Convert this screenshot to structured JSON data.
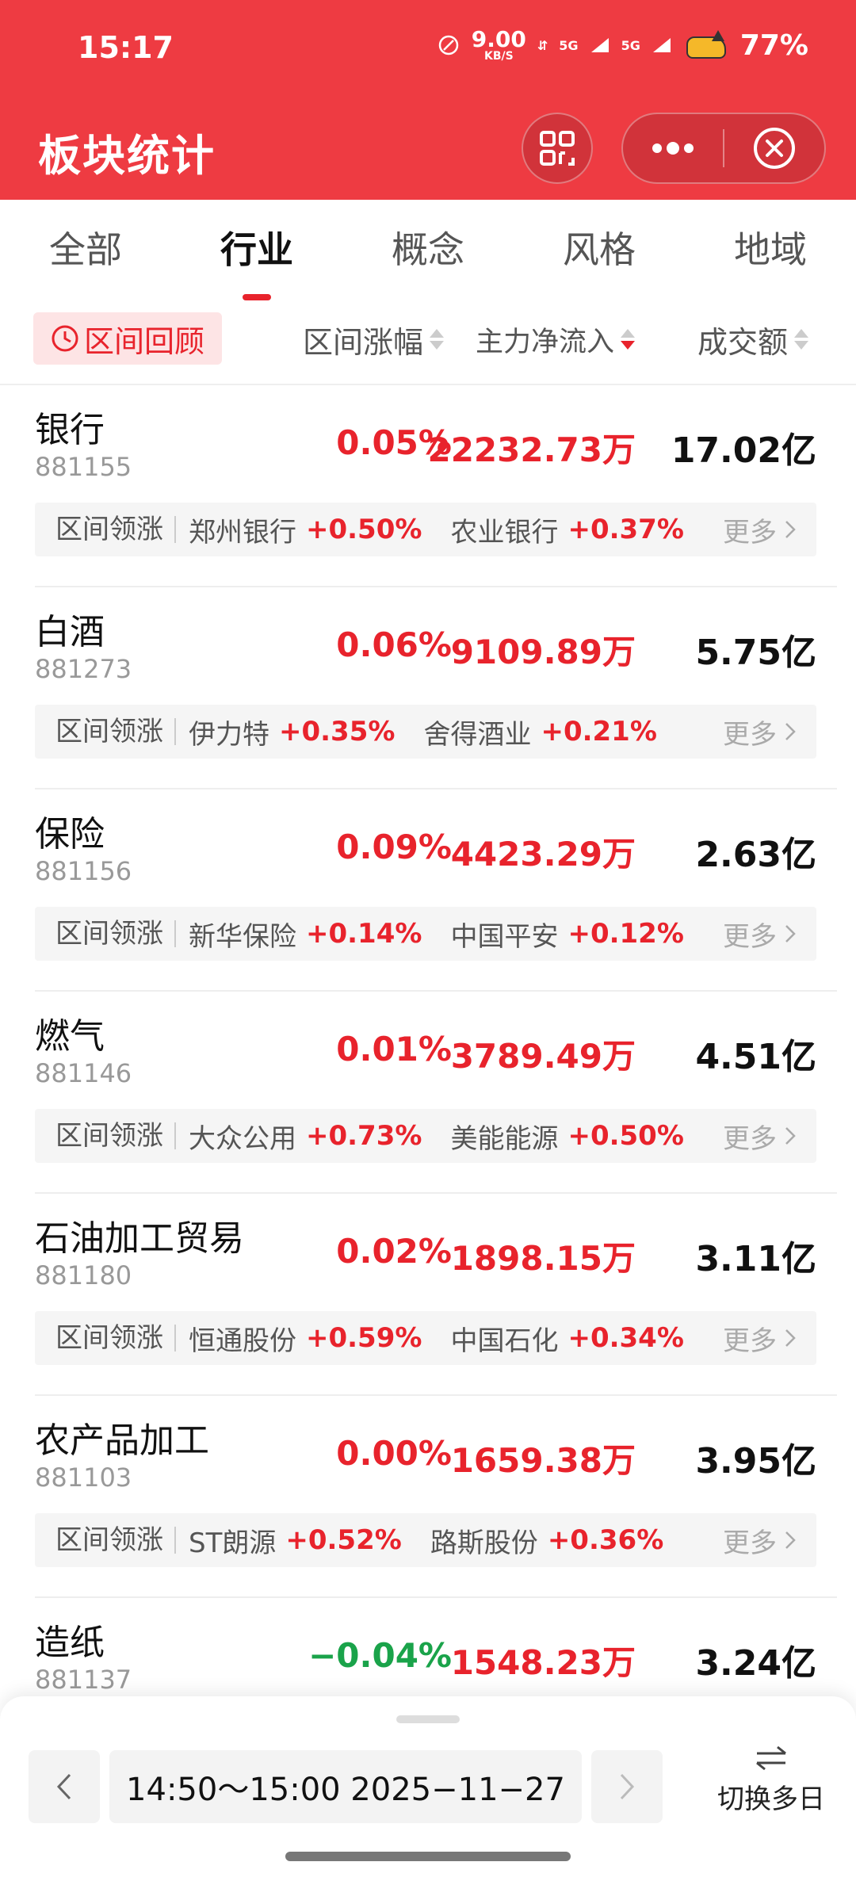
{
  "status_bar": {
    "time": "15:17",
    "speed_value": "9.00",
    "speed_unit": "KB/S",
    "network_1": "5G",
    "network_2": "5G",
    "battery": "77%"
  },
  "header": {
    "title": "板块统计"
  },
  "tabs": [
    {
      "label": "全部",
      "active": false
    },
    {
      "label": "行业",
      "active": true
    },
    {
      "label": "概念",
      "active": false
    },
    {
      "label": "风格",
      "active": false
    },
    {
      "label": "地域",
      "active": false
    }
  ],
  "columns": {
    "range_review": "区间回顾",
    "range_change": "区间涨幅",
    "main_net_inflow": "主力净流入",
    "turnover": "成交额",
    "sorted_by": "main_net_inflow",
    "sort_direction": "desc"
  },
  "rows": [
    {
      "name": "银行",
      "code": "881155",
      "change": "0.05%",
      "change_color": "#e8232c",
      "inflow": "22232.73万",
      "turnover": "17.02亿",
      "leader_label": "区间领涨",
      "stock1": "郑州银行",
      "gain1": "+0.50%",
      "stock2": "农业银行",
      "gain2": "+0.37%",
      "more": "更多"
    },
    {
      "name": "白酒",
      "code": "881273",
      "change": "0.06%",
      "change_color": "#e8232c",
      "inflow": "9109.89万",
      "turnover": "5.75亿",
      "leader_label": "区间领涨",
      "stock1": "伊力特",
      "gain1": "+0.35%",
      "stock2": "舍得酒业",
      "gain2": "+0.21%",
      "more": "更多"
    },
    {
      "name": "保险",
      "code": "881156",
      "change": "0.09%",
      "change_color": "#e8232c",
      "inflow": "4423.29万",
      "turnover": "2.63亿",
      "leader_label": "区间领涨",
      "stock1": "新华保险",
      "gain1": "+0.14%",
      "stock2": "中国平安",
      "gain2": "+0.12%",
      "more": "更多"
    },
    {
      "name": "燃气",
      "code": "881146",
      "change": "0.01%",
      "change_color": "#e8232c",
      "inflow": "3789.49万",
      "turnover": "4.51亿",
      "leader_label": "区间领涨",
      "stock1": "大众公用",
      "gain1": "+0.73%",
      "stock2": "美能能源",
      "gain2": "+0.50%",
      "more": "更多"
    },
    {
      "name": "石油加工贸易",
      "code": "881180",
      "change": "0.02%",
      "change_color": "#e8232c",
      "inflow": "1898.15万",
      "turnover": "3.11亿",
      "leader_label": "区间领涨",
      "stock1": "恒通股份",
      "gain1": "+0.59%",
      "stock2": "中国石化",
      "gain2": "+0.34%",
      "more": "更多"
    },
    {
      "name": "农产品加工",
      "code": "881103",
      "change": "0.00%",
      "change_color": "#e8232c",
      "inflow": "1659.38万",
      "turnover": "3.95亿",
      "leader_label": "区间领涨",
      "stock1": "ST朗源",
      "gain1": "+0.52%",
      "stock2": "路斯股份",
      "gain2": "+0.36%",
      "more": "更多"
    },
    {
      "name": "造纸",
      "code": "881137",
      "change": "−0.04%",
      "change_color": "#1aa34a",
      "inflow": "1548.23万",
      "turnover": "3.24亿"
    }
  ],
  "bottom": {
    "date_range": "14:50～15:00 2025−11−27",
    "multi_day": "切换多日"
  },
  "colors": {
    "brand_red": "#ee3b42",
    "up_red": "#e8232c",
    "down_green": "#1aa34a"
  }
}
